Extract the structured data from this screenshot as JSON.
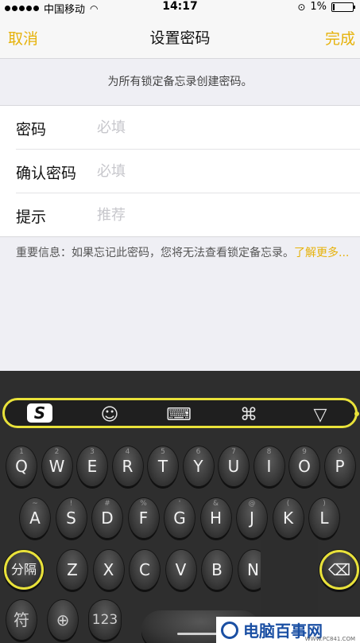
{
  "status_bar": {
    "carrier": "中国移动",
    "time": "14:17",
    "battery": "1%",
    "battery_level": 0.01,
    "signal_icon": "signal-dots-icon",
    "wifi_icon": "wifi-icon",
    "lock_icon": "rotation-lock-icon"
  },
  "nav": {
    "cancel": "取消",
    "title": "设置密码",
    "done": "完成",
    "accent_color": "#e6b20a"
  },
  "header_note": "为所有锁定备忘录创建密码。",
  "form": {
    "password": {
      "label": "密码",
      "placeholder": "必填",
      "value": ""
    },
    "confirm": {
      "label": "确认密码",
      "placeholder": "必填",
      "value": ""
    },
    "hint": {
      "label": "提示",
      "placeholder": "推荐",
      "value": ""
    }
  },
  "info": {
    "text": "重要信息：如果忘记此密码，您将无法查看锁定备忘录。",
    "link": "了解更多..."
  },
  "keyboard": {
    "toolbar_icons": [
      "sogou-logo-icon",
      "emoji-icon",
      "keyboard-icon",
      "command-icon",
      "collapse-icon"
    ],
    "sogou": "S",
    "emoji": "☺",
    "kbd": "⌨",
    "cmd": "⌘",
    "collapse": "▽",
    "row1": [
      {
        "key": "Q",
        "sub": "1"
      },
      {
        "key": "W",
        "sub": "2"
      },
      {
        "key": "E",
        "sub": "3"
      },
      {
        "key": "R",
        "sub": "4"
      },
      {
        "key": "T",
        "sub": "5"
      },
      {
        "key": "Y",
        "sub": "6"
      },
      {
        "key": "U",
        "sub": "7"
      },
      {
        "key": "I",
        "sub": "8"
      },
      {
        "key": "O",
        "sub": "9"
      },
      {
        "key": "P",
        "sub": "0"
      }
    ],
    "row2": [
      {
        "key": "A",
        "sub": "~"
      },
      {
        "key": "S",
        "sub": "!"
      },
      {
        "key": "D",
        "sub": "#"
      },
      {
        "key": "F",
        "sub": "%"
      },
      {
        "key": "G",
        "sub": "'"
      },
      {
        "key": "H",
        "sub": "&"
      },
      {
        "key": "J",
        "sub": "@"
      },
      {
        "key": "K",
        "sub": "("
      },
      {
        "key": "L",
        "sub": ")"
      }
    ],
    "row3": [
      {
        "key": "Z",
        "sub": ""
      },
      {
        "key": "X",
        "sub": ""
      },
      {
        "key": "C",
        "sub": ""
      },
      {
        "key": "V",
        "sub": ""
      },
      {
        "key": "B",
        "sub": ""
      },
      {
        "key": "N",
        "sub": ""
      }
    ],
    "split": "分隔",
    "symbol": "符",
    "globe": "🌐",
    "num": "123",
    "delete_icon": "delete-icon"
  },
  "watermark": {
    "text": "电脑百事网",
    "sub": "WWW.PC841.COM"
  }
}
